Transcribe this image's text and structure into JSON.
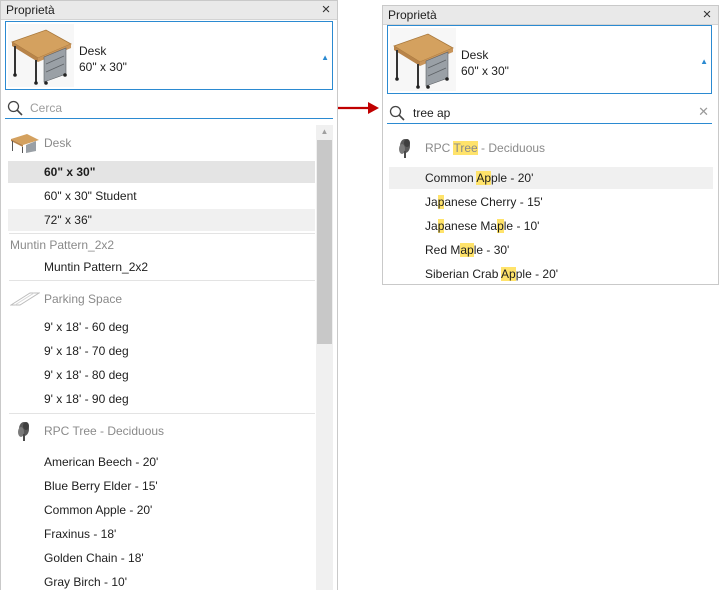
{
  "left_panel": {
    "title": "Proprietà",
    "close_icon": "×",
    "type_selector": {
      "name": "Desk",
      "size": "60\" x 30\""
    },
    "search": {
      "placeholder": "Cerca",
      "value": ""
    },
    "groups": [
      {
        "label": "Desk",
        "icon": "desk-icon",
        "items": [
          "60\" x 30\"",
          "60\" x 30\" Student",
          "72\" x 36\""
        ],
        "selected_index": 0,
        "hover_index": 2
      },
      {
        "label": "Muntin Pattern_2x2",
        "icon": "",
        "items": [
          "Muntin Pattern_2x2"
        ]
      },
      {
        "label": "Parking Space",
        "icon": "parking-space-icon",
        "items": [
          "9' x 18' - 60 deg",
          "9' x 18' - 70 deg",
          "9' x 18' - 80 deg",
          "9' x 18' - 90 deg"
        ]
      },
      {
        "label": "RPC Tree - Deciduous",
        "icon": "tree-icon",
        "items": [
          "American Beech - 20'",
          "Blue Berry Elder - 15'",
          "Common Apple - 20'",
          "Fraxinus - 18'",
          "Golden Chain - 18'",
          "Gray Birch - 10'"
        ]
      }
    ]
  },
  "right_panel": {
    "title": "Proprietà",
    "close_icon": "×",
    "type_selector": {
      "name": "Desk",
      "size": "60\" x 30\""
    },
    "search": {
      "placeholder": "Cerca",
      "value": "tree ap"
    },
    "group": {
      "label_parts": [
        {
          "t": "RPC ",
          "h": false
        },
        {
          "t": "Tree",
          "h": true
        },
        {
          "t": " - Deciduous",
          "h": false
        }
      ],
      "icon": "tree-icon"
    },
    "items": [
      [
        {
          "t": "Common ",
          "h": false
        },
        {
          "t": "Ap",
          "h": true
        },
        {
          "t": "ple - 20'",
          "h": false
        }
      ],
      [
        {
          "t": "Ja",
          "h": false
        },
        {
          "t": "p",
          "h": true
        },
        {
          "t": "anese Cherry - 15'",
          "h": false
        }
      ],
      [
        {
          "t": "Ja",
          "h": false
        },
        {
          "t": "p",
          "h": true
        },
        {
          "t": "anese Ma",
          "h": false
        },
        {
          "t": "p",
          "h": true
        },
        {
          "t": "le - 10'",
          "h": false
        }
      ],
      [
        {
          "t": "Red M",
          "h": false
        },
        {
          "t": "ap",
          "h": true
        },
        {
          "t": "le - 30'",
          "h": false
        }
      ],
      [
        {
          "t": "Siberian Crab ",
          "h": false
        },
        {
          "t": "Ap",
          "h": true
        },
        {
          "t": "ple - 20'",
          "h": false
        }
      ]
    ],
    "hover_index": 0
  },
  "colors": {
    "accent": "#2b8ad1",
    "highlight": "#ffe36b",
    "arrow": "#c00000"
  }
}
